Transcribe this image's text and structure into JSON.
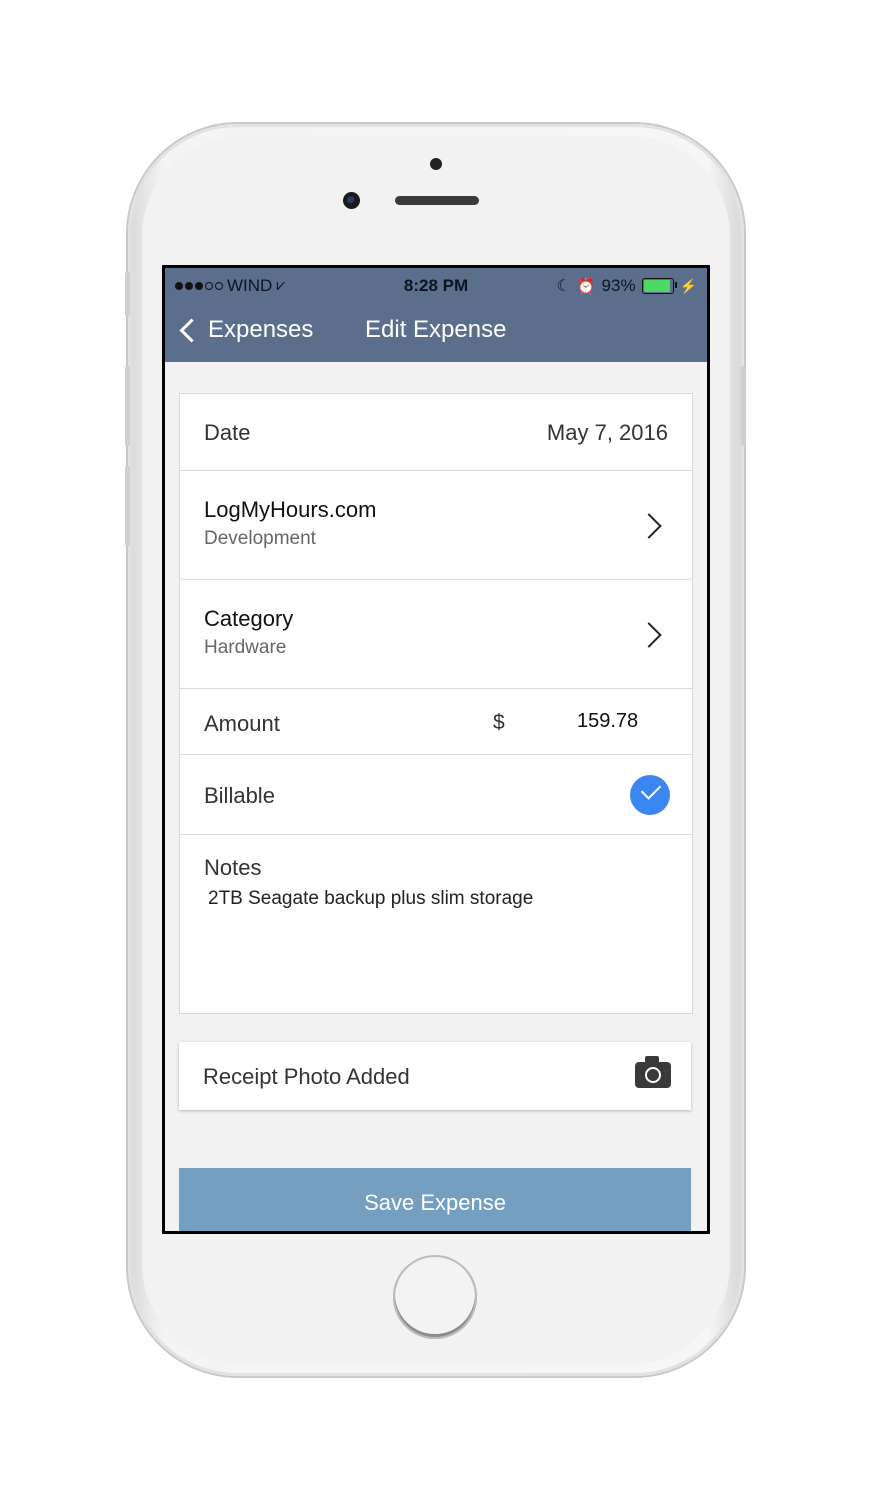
{
  "status_bar": {
    "carrier": "WIND",
    "time": "8:28 PM",
    "battery": "93%",
    "battery_level": 0.93,
    "signal_bars_filled": 3,
    "signal_bars_total": 5
  },
  "nav": {
    "back_label": "Expenses",
    "title": "Edit Expense"
  },
  "form": {
    "date_label": "Date",
    "date_value": "May 7, 2016",
    "client_name": "LogMyHours.com",
    "client_project": "Development",
    "category_label": "Category",
    "category_value": "Hardware",
    "amount_label": "Amount",
    "currency_symbol": "$",
    "amount_value": "159.78",
    "billable_label": "Billable",
    "billable_checked": true,
    "notes_label": "Notes",
    "notes_value": "2TB Seagate backup plus slim storage"
  },
  "receipt": {
    "label": "Receipt Photo Added",
    "icon": "camera-icon"
  },
  "actions": {
    "save_label": "Save Expense"
  },
  "colors": {
    "nav_bg": "#5b6f8c",
    "save_bg": "#759fc1",
    "check_bg": "#3b86f0",
    "battery_fill": "#4cd964"
  }
}
